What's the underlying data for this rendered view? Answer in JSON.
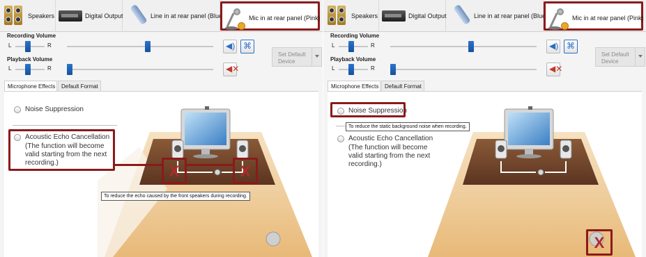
{
  "device_tabs": {
    "speakers": "Speakers",
    "digital_output": "Digital Output",
    "line_in": "Line in at rear panel (Blue)",
    "mic_in": "Mic in at rear panel (Pink)"
  },
  "recording_volume": {
    "label": "Recording Volume",
    "left": "L",
    "right": "R",
    "level": 0.56
  },
  "playback_volume": {
    "label": "Playback Volume",
    "left": "L",
    "right": "R",
    "level": 0.02
  },
  "set_default": {
    "label": "Set Default\nDevice"
  },
  "effect_tabs": {
    "microphone_effects": "Microphone Effects",
    "default_format": "Default Format"
  },
  "options": {
    "noise_suppression": "Noise Suppression",
    "echo_cancellation": "Acoustic Echo Cancellation",
    "echo_desc": "(The function will become valid starting from the next recording.)"
  },
  "tooltips": {
    "echo": "To reduce the echo caused by the front speakers during recording.",
    "noise": "To reduce the static background noise when recording."
  },
  "icons": {
    "mute": "speaker-volume-icon",
    "mic_boost": "microphone-array-icon",
    "mute_off": "speaker-muted-icon"
  },
  "colors": {
    "highlight": "#8b1a1a",
    "slider": "#1f62b3"
  }
}
